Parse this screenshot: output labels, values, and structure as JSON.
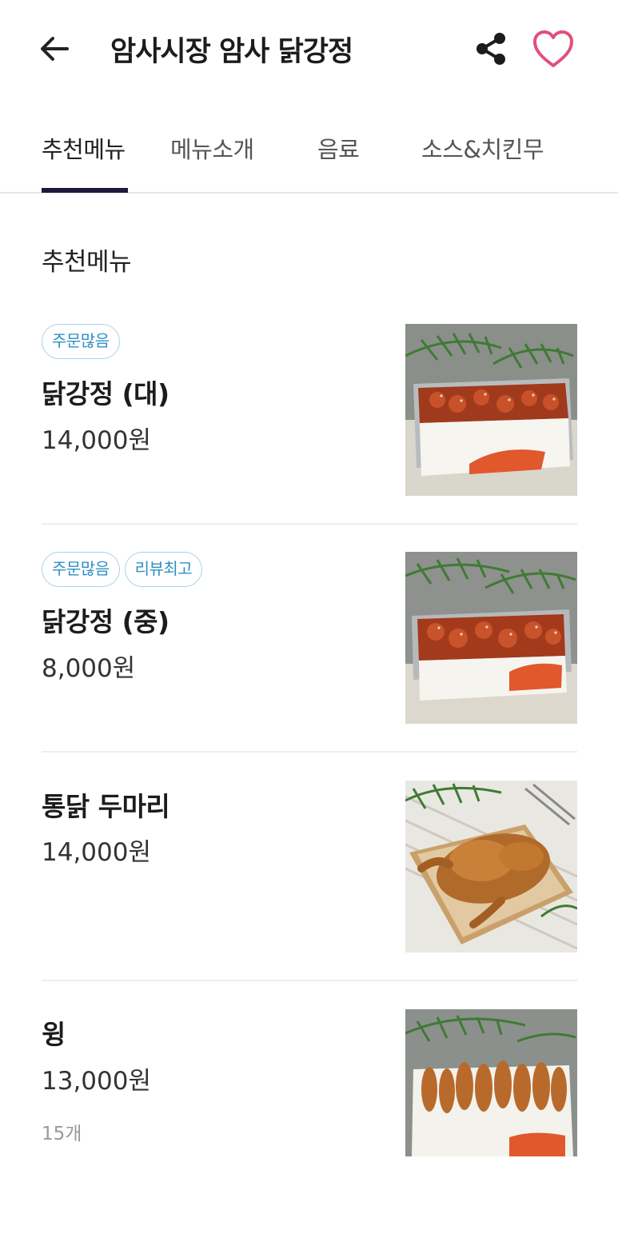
{
  "header": {
    "title": "암사시장 암사 닭강정"
  },
  "tabs": [
    {
      "label": "추천메뉴",
      "active": true
    },
    {
      "label": "메뉴소개",
      "active": false
    },
    {
      "label": "음료",
      "active": false
    },
    {
      "label": "소스&치킨무",
      "active": false
    }
  ],
  "section": {
    "title": "추천메뉴"
  },
  "items": [
    {
      "badges": [
        "주문많음"
      ],
      "name": "닭강정 (대)",
      "price": "14,000원",
      "count": "",
      "image": "fried-chicken-gangjeong-large-box"
    },
    {
      "badges": [
        "주문많음",
        "리뷰최고"
      ],
      "name": "닭강정 (중)",
      "price": "8,000원",
      "count": "",
      "image": "fried-chicken-gangjeong-medium-box"
    },
    {
      "badges": [],
      "name": "통닭 두마리",
      "price": "14,000원",
      "count": "",
      "image": "whole-fried-chicken-tray"
    },
    {
      "badges": [],
      "name": "윙",
      "price": "13,000원",
      "count": "15개",
      "image": "fried-chicken-wings-box"
    }
  ],
  "colors": {
    "accent_heart": "#e0507a",
    "badge_text": "#2f90c5",
    "badge_border": "#a9d2e6",
    "tab_underline": "#1b1a3a"
  }
}
